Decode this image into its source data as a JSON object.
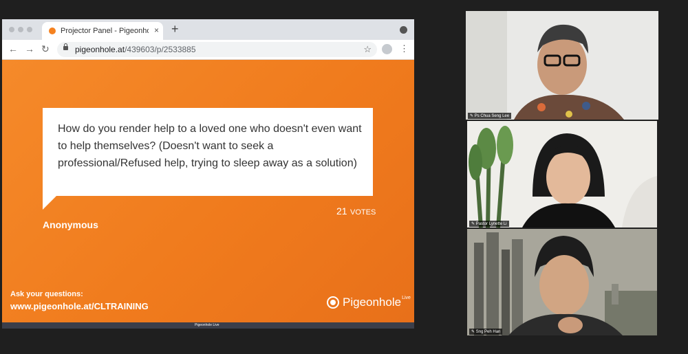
{
  "browser": {
    "tab_title": "Projector Panel - Pigeonhole L",
    "tab_close": "×",
    "new_tab": "+",
    "url_domain": "pigeonhole.at",
    "url_path": "/439603/p/2533885"
  },
  "slide": {
    "question": "How do you render help to a loved one who doesn't even want to help themselves? (Doesn't want to seek a professional/Refused help, trying to sleep away as a solution)",
    "votes_count": "21",
    "votes_label": "VOTES",
    "author": "Anonymous",
    "ask_label": "Ask your questions:",
    "ask_url": "www.pigeonhole.at/CLTRAINING",
    "brand_name": "Pigeonhole",
    "brand_sup": "Live",
    "footer_text": "Pigeonhole Live"
  },
  "participants": [
    {
      "name": "Ps Chua Seng Lee"
    },
    {
      "name": "Pastor Lynette Li"
    },
    {
      "name": "Sng Peh Han"
    }
  ],
  "colors": {
    "slide_orange": "#f07b1d",
    "active_speaker_border": "#9fd83c",
    "footer_bar": "#3b3e4a"
  },
  "icons": [
    "lock-icon",
    "star-icon",
    "back-icon",
    "forward-icon",
    "reload-icon",
    "profile-icon",
    "menu-icon",
    "pin-icon",
    "pigeonhole-logo-icon"
  ]
}
